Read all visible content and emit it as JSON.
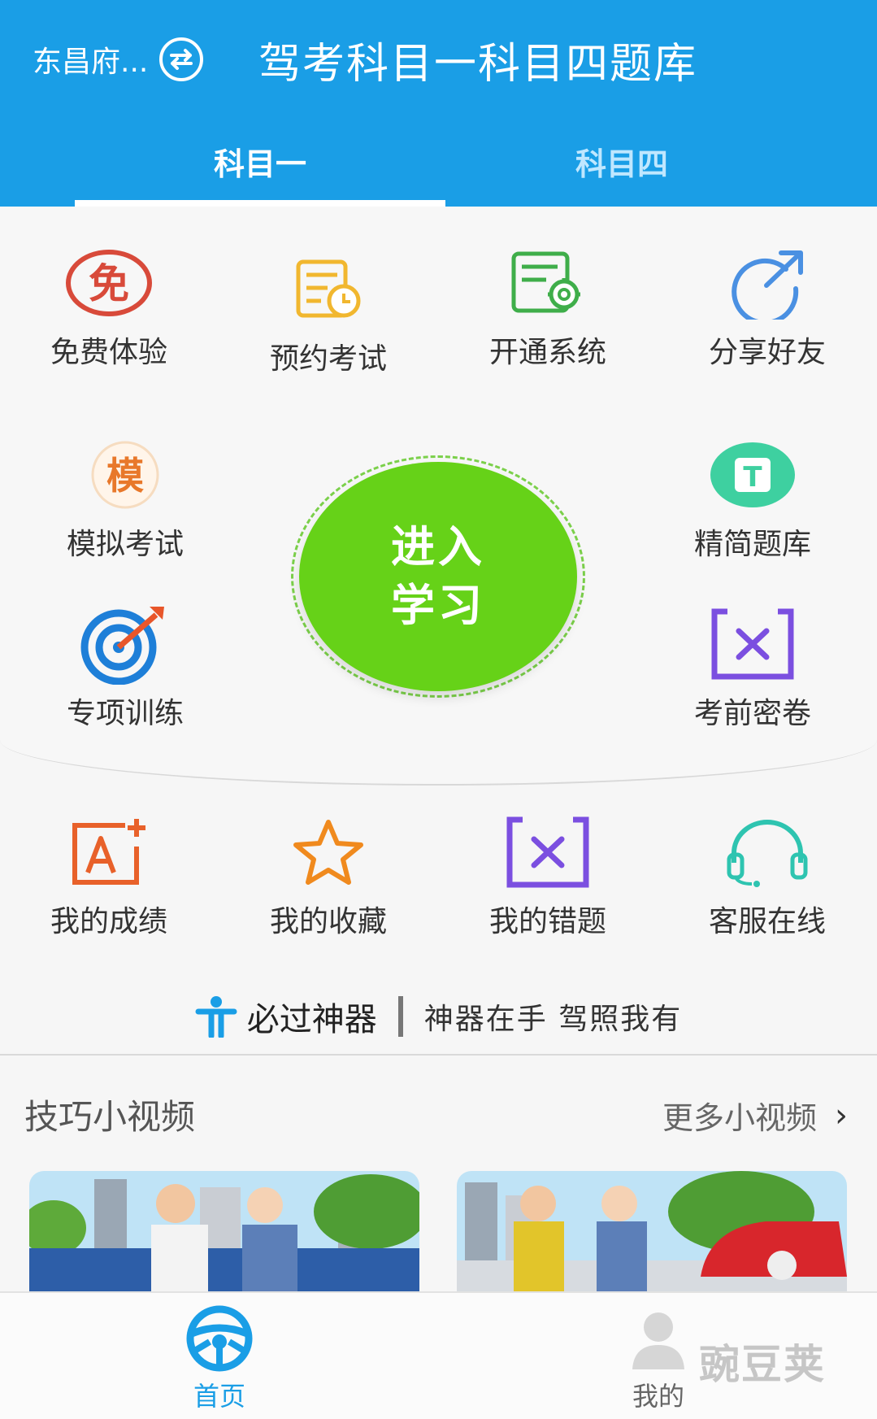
{
  "header": {
    "city": "东昌府...",
    "title": "驾考科目一科目四题库",
    "tabs": [
      {
        "label": "科目一",
        "active": true
      },
      {
        "label": "科目四",
        "active": false
      }
    ]
  },
  "top_grid": [
    {
      "label": "免费体验",
      "icon": "free-icon",
      "glyph": "免"
    },
    {
      "label": "预约考试",
      "icon": "appointment-icon"
    },
    {
      "label": "开通系统",
      "icon": "activate-system-icon"
    },
    {
      "label": "分享好友",
      "icon": "share-icon"
    }
  ],
  "side_left": [
    {
      "label": "模拟考试",
      "icon": "mock-exam-icon",
      "glyph": "模"
    },
    {
      "label": "专项训练",
      "icon": "target-icon"
    }
  ],
  "side_right": [
    {
      "label": "精简题库",
      "icon": "question-bank-icon",
      "glyph": "T"
    },
    {
      "label": "考前密卷",
      "icon": "secret-paper-icon"
    }
  ],
  "center_button": {
    "line1": "进入",
    "line2": "学习"
  },
  "bottom_grid": [
    {
      "label": "我的成绩",
      "icon": "score-icon"
    },
    {
      "label": "我的收藏",
      "icon": "star-icon"
    },
    {
      "label": "我的错题",
      "icon": "wrong-questions-icon"
    },
    {
      "label": "客服在线",
      "icon": "headset-icon"
    }
  ],
  "promo": {
    "title": "必过神器",
    "slogan": "神器在手  驾照我有"
  },
  "videos": {
    "title": "技巧小视频",
    "more": "更多小视频"
  },
  "nav": {
    "home": "首页",
    "me": "我的",
    "watermark": "豌豆荚"
  },
  "colors": {
    "header_blue": "#1a9ee6",
    "enter_green": "#66d218",
    "free_red": "#d84a3a",
    "appointment_yellow": "#f1b72f",
    "activate_green": "#3fae4a",
    "share_blue": "#4a90e2",
    "mock_orange": "#e8782a",
    "bank_teal": "#3ed0a0",
    "paper_purple": "#7b4fe0",
    "score_orange": "#e8612a",
    "star_orange": "#f08a1e",
    "headset_teal": "#2ec4b0"
  }
}
